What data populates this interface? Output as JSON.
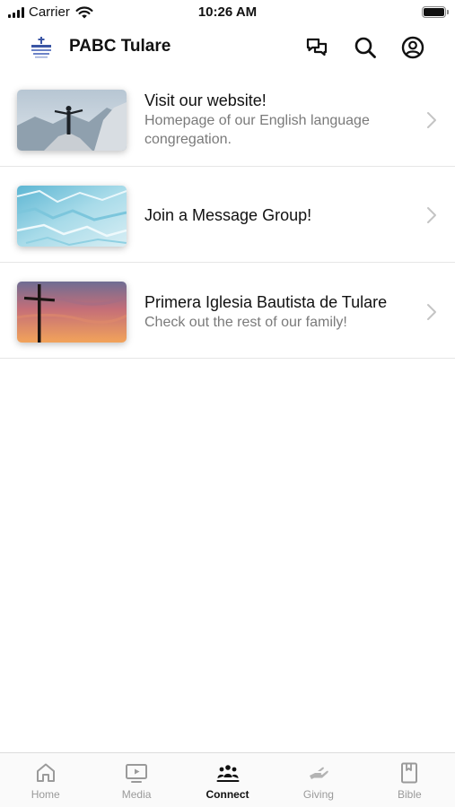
{
  "status_bar": {
    "carrier": "Carrier",
    "time": "10:26 AM"
  },
  "header": {
    "title": "PABC Tulare",
    "logo_icon": "church-logo-icon",
    "actions": [
      "chat-icon",
      "search-icon",
      "account-icon"
    ]
  },
  "links": [
    {
      "title": "Visit our website!",
      "subtitle": "Homepage of our English language congregation.",
      "image": "man-on-mountain-peak"
    },
    {
      "title": "Join a Message Group!",
      "subtitle": "",
      "image": "icy-blue-water"
    },
    {
      "title": "Primera Iglesia Bautista de Tulare",
      "subtitle": "Check out the rest of our family!",
      "image": "cross-at-sunset"
    }
  ],
  "tabs": [
    {
      "label": "Home",
      "icon": "home-icon"
    },
    {
      "label": "Media",
      "icon": "media-play-icon"
    },
    {
      "label": "Connect",
      "icon": "people-group-icon",
      "active": true
    },
    {
      "label": "Giving",
      "icon": "giving-hand-icon"
    },
    {
      "label": "Bible",
      "icon": "bible-book-icon"
    }
  ],
  "colors": {
    "text": "#111111",
    "subtext": "#7a7a7a",
    "inactive_tab": "#9a9a9a",
    "divider": "#e6e6e6"
  }
}
